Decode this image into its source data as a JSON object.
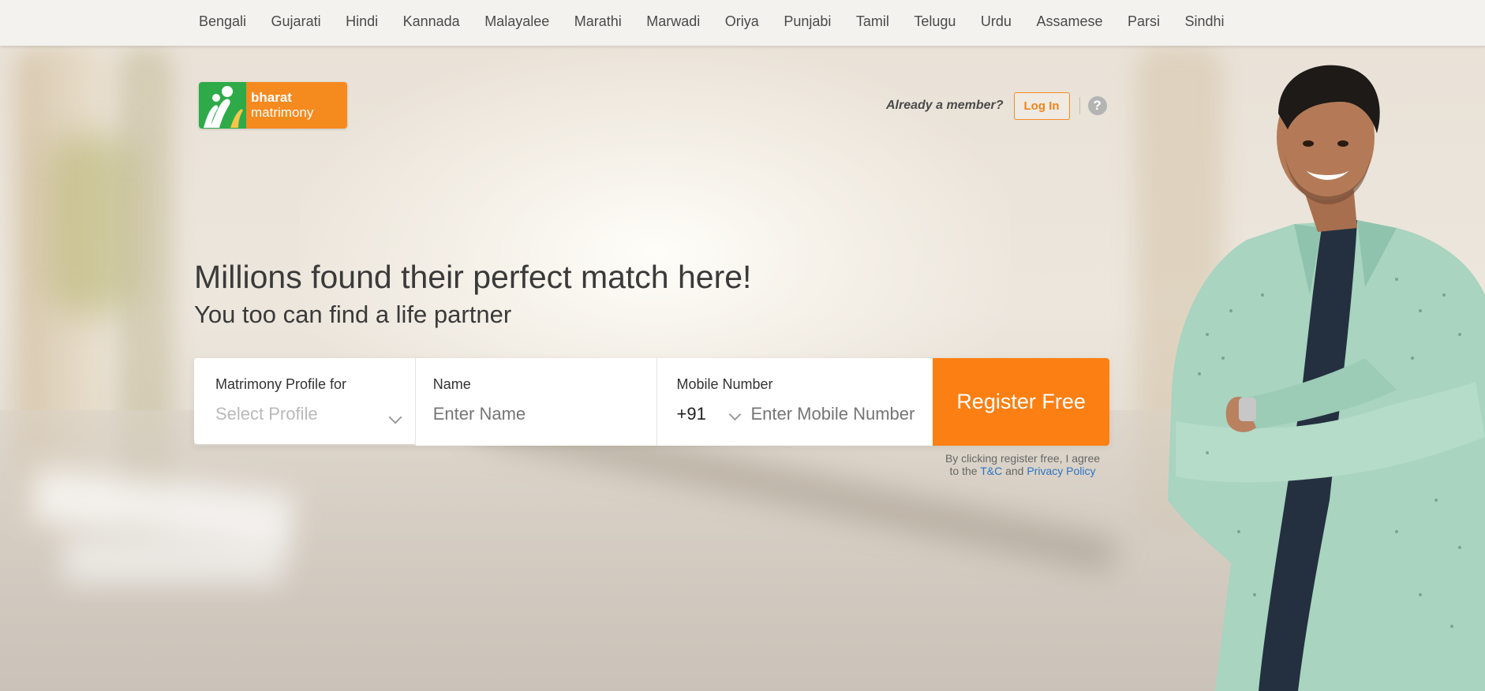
{
  "languages": [
    "Bengali",
    "Gujarati",
    "Hindi",
    "Kannada",
    "Malayalee",
    "Marathi",
    "Marwadi",
    "Oriya",
    "Punjabi",
    "Tamil",
    "Telugu",
    "Urdu",
    "Assamese",
    "Parsi",
    "Sindhi"
  ],
  "logo": {
    "line1": "bharat",
    "line2": "matrimony"
  },
  "member": {
    "prompt": "Already a member?",
    "login_label": "Log In",
    "help_symbol": "?"
  },
  "hero": {
    "headline": "Millions found their perfect match here!",
    "subheadline": "You too can find a life partner"
  },
  "form": {
    "profile_label": "Matrimony Profile for",
    "profile_placeholder": "Select Profile",
    "name_label": "Name",
    "name_placeholder": "Enter Name",
    "mobile_label": "Mobile Number",
    "country_code": "+91",
    "mobile_placeholder": "Enter Mobile Number",
    "register_label": "Register Free"
  },
  "terms": {
    "line1": "By clicking register free, I agree",
    "prefix": "to the",
    "tc_link": "T&C",
    "and": "and",
    "privacy_link": "Privacy Policy"
  },
  "colors": {
    "brand_orange": "#fb7f13",
    "brand_green": "#2eaa49",
    "link_blue": "#2a73c6"
  }
}
